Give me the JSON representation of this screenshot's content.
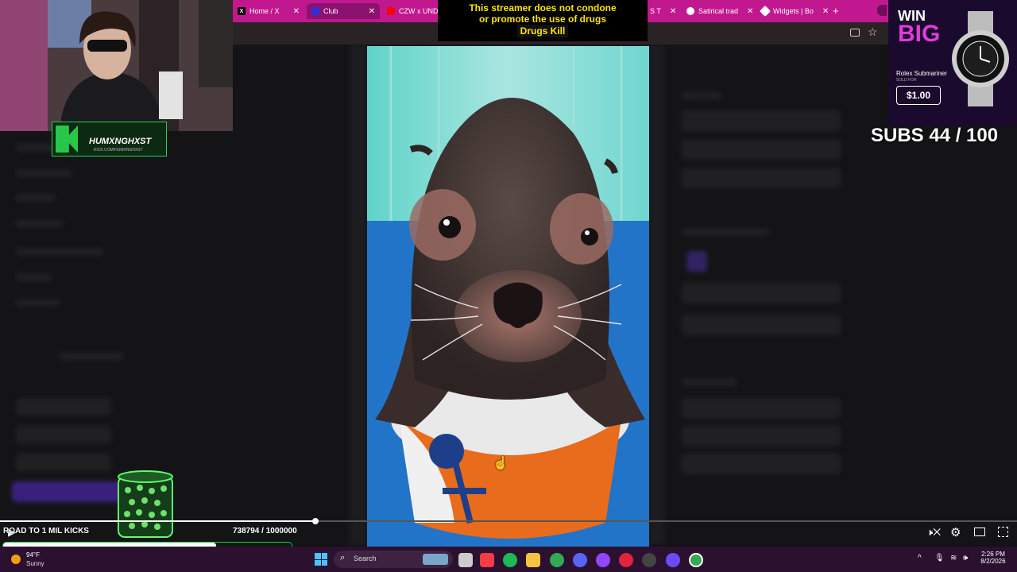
{
  "browser": {
    "tabs": [
      {
        "label": "Home / X",
        "icon": "x-logo-icon",
        "color": "#000000"
      },
      {
        "label": "Club",
        "icon": "club-icon",
        "color": "#2f2fd8"
      },
      {
        "label": "CZW x UND",
        "icon": "youtube-icon",
        "color": "#ff0000"
      },
      {
        "label": "S T",
        "icon": "tab-icon",
        "color": "#ffffff"
      },
      {
        "label": "Satirical trad",
        "icon": "chrome-icon",
        "color": "#4caf50"
      },
      {
        "label": "Widgets | Bo",
        "icon": "widget-icon",
        "color": "#ffffff"
      }
    ],
    "new_tab_label": "+"
  },
  "overlay": {
    "disclaimer_line1": "This streamer does not condone",
    "disclaimer_line2": "or promote the use of drugs",
    "disclaimer_line3": "Drugs Kill",
    "webcam_name": "HUMXNGHXST",
    "webcam_url": "KICK.COM/HUMXNGHXST",
    "win_line1": "WIN",
    "win_line2": "BIG",
    "prize_name": "Rolex Submariner",
    "prize_sold": "SOLD FOR",
    "prize_price": "$1.00",
    "subs_goal": "SUBS 44 / 100",
    "road_label": "ROAD TO 1 MIL KICKS",
    "kicks_count": "738794 / 1000000",
    "kicks_progress": 0.738794
  },
  "player": {
    "progress": 0.31,
    "icons": [
      "play-icon",
      "mute-icon",
      "settings-icon",
      "theater-icon",
      "fullscreen-icon"
    ]
  },
  "taskbar": {
    "weather_temp": "94°F",
    "weather_desc": "Sunny",
    "search_placeholder": "Search",
    "time": "2:26 PM",
    "date": "8/2/2026"
  }
}
